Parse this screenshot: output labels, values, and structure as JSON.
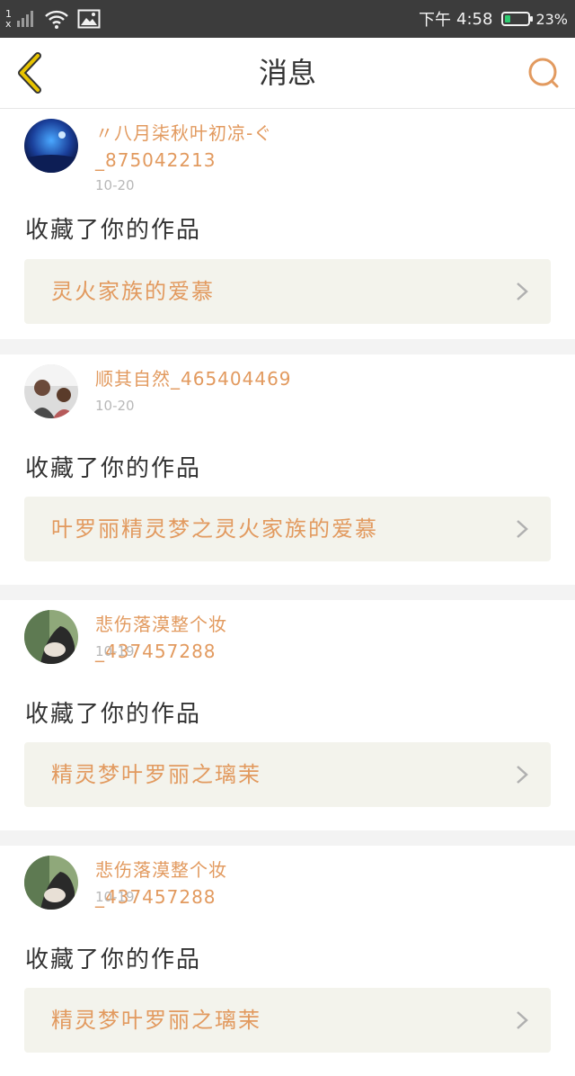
{
  "status_bar": {
    "sim_top": "1",
    "sim_bottom": "x",
    "time_prefix": "下午",
    "time": "4:58",
    "battery": "23%",
    "battery_level": 0.23
  },
  "header": {
    "title": "消息"
  },
  "messages": [
    {
      "username": "〃八月柒秋叶初凉-ぐ_875042213",
      "date": "10-20",
      "action": "收藏了你的作品",
      "work_title": "灵火家族的爱慕"
    },
    {
      "username": "顺其自然_465404469",
      "date": "10-20",
      "action": "收藏了你的作品",
      "work_title": "叶罗丽精灵梦之灵火家族的爱慕"
    },
    {
      "username": "悲伤落漠整个妆_437457288",
      "date": "10-19",
      "action": "收藏了你的作品",
      "work_title": "精灵梦叶罗丽之璃茉"
    },
    {
      "username": "悲伤落漠整个妆_437457288",
      "date": "10-19",
      "action": "收藏了你的作品",
      "work_title": "精灵梦叶罗丽之璃茉"
    }
  ],
  "colors": {
    "accent": "#e29a5f",
    "back_arrow": "#e8c400",
    "card_bg": "#f3f3ec",
    "status_bar": "#3c3c3c"
  },
  "icons": {
    "back": "chevron-left-icon",
    "search": "search-icon",
    "row_arrow": "chevron-right-icon"
  }
}
